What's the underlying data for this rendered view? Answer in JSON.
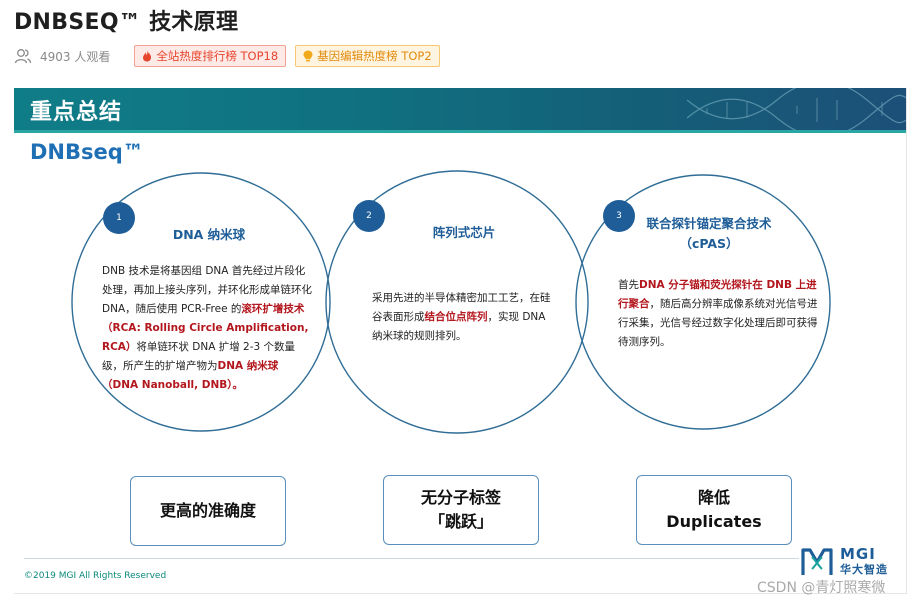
{
  "header": {
    "title": "DNBSEQ™ 技术原理",
    "viewers": "4903 人观看",
    "badges": [
      {
        "label": "全站热度排行榜 TOP18",
        "icon": "flame-icon",
        "color": "#e6452d"
      },
      {
        "label": "基因编辑热度榜 TOP2",
        "icon": "lightbulb-icon",
        "color": "#e08b0d"
      }
    ]
  },
  "slide": {
    "banner_title": "重点总结",
    "subtitle": "DNBseq™",
    "circles": [
      {
        "number": "1",
        "heading": "DNA 纳米球",
        "body": [
          {
            "text": "DNB 技术是将基因组 DNA 首先经过片段化处理，再加上接头序列，并环化形成单链环化 DNA，随后使用 PCR-Free 的",
            "hl": false
          },
          {
            "text": "滚环扩增技术 （RCA: Rolling Circle Amplification, RCA）",
            "hl": true
          },
          {
            "text": "将单链环状 DNA 扩增 2-3 个数量级，所产生的扩增产物为",
            "hl": false
          },
          {
            "text": "DNA 纳米球（DNA Nanoball, DNB）。",
            "hl": true
          }
        ]
      },
      {
        "number": "2",
        "heading": "阵列式芯片",
        "body": [
          {
            "text": "采用先进的半导体精密加工工艺，在硅谷表面形成",
            "hl": false
          },
          {
            "text": "结合位点阵列",
            "hl": true
          },
          {
            "text": "，实现 DNA 纳米球的规则排列。",
            "hl": false
          }
        ]
      },
      {
        "number": "3",
        "heading_line1": "联合探针锚定聚合技术",
        "heading_line2": "（cPAS）",
        "body": [
          {
            "text": "首先",
            "hl": false
          },
          {
            "text": "DNA 分子锚和荧光探针在 DNB 上进行聚合",
            "hl": true
          },
          {
            "text": "，随后高分辨率成像系统对光信号进行采集，光信号经过数字化处理后即可获得待测序列。",
            "hl": false
          }
        ]
      }
    ],
    "advantages": [
      {
        "line1": "更高的准确度",
        "line2": ""
      },
      {
        "line1": "无分子标签",
        "line2": "「跳跃」"
      },
      {
        "line1": "降低",
        "line2": "Duplicates"
      }
    ],
    "copyright": "©2019 MGI All Rights Reserved",
    "logo": {
      "mgi": "MGI",
      "cn": "华大智造"
    }
  },
  "watermark": "CSDN @青灯照寒微",
  "colors": {
    "accent": "#1e5d97",
    "highlight": "#b3171e",
    "banner": "#10707f"
  }
}
